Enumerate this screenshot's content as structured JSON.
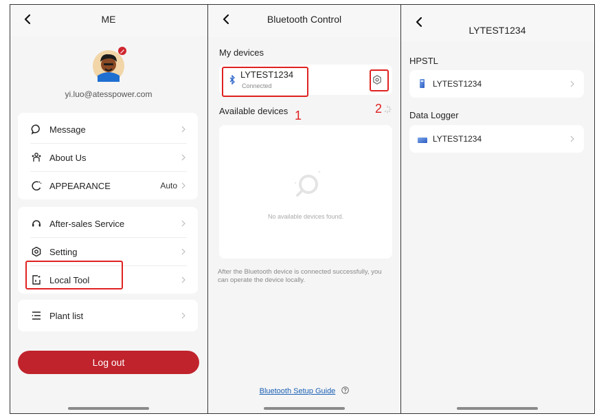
{
  "panel1": {
    "title": "ME",
    "email": "yi.luo@atesspower.com",
    "menu_group1": [
      {
        "label": "Message",
        "icon": "message-icon"
      },
      {
        "label": "About Us",
        "icon": "people-icon"
      },
      {
        "label": "APPEARANCE",
        "icon": "theme-icon",
        "value": "Auto"
      }
    ],
    "menu_group2": [
      {
        "label": "After-sales Service",
        "icon": "headset-icon"
      },
      {
        "label": "Setting",
        "icon": "gear-icon"
      },
      {
        "label": "Local Tool",
        "icon": "local-tool-icon"
      }
    ],
    "menu_group3": [
      {
        "label": "Plant list",
        "icon": "list-icon"
      }
    ],
    "logout_label": "Log out"
  },
  "panel2": {
    "title": "Bluetooth Control",
    "my_devices_label": "My devices",
    "device_name": "LYTEST1234",
    "device_status": "Connected",
    "available_label": "Available devices",
    "empty_text": "No available devices found.",
    "hint": "After the Bluetooth device is connected successfully, you can operate the device locally.",
    "guide_link": "Bluetooth Setup Guide",
    "annotation_1": "1",
    "annotation_2": "2"
  },
  "panel3": {
    "title": "LYTEST1234",
    "section1_label": "HPSTL",
    "section1_item": "LYTEST1234",
    "section2_label": "Data Logger",
    "section2_item": "LYTEST1234"
  },
  "colors": {
    "accent_red": "#c0232c",
    "annotation_red": "#e02020",
    "link_blue": "#1a5fb4",
    "device_blue": "#2a64c8"
  }
}
